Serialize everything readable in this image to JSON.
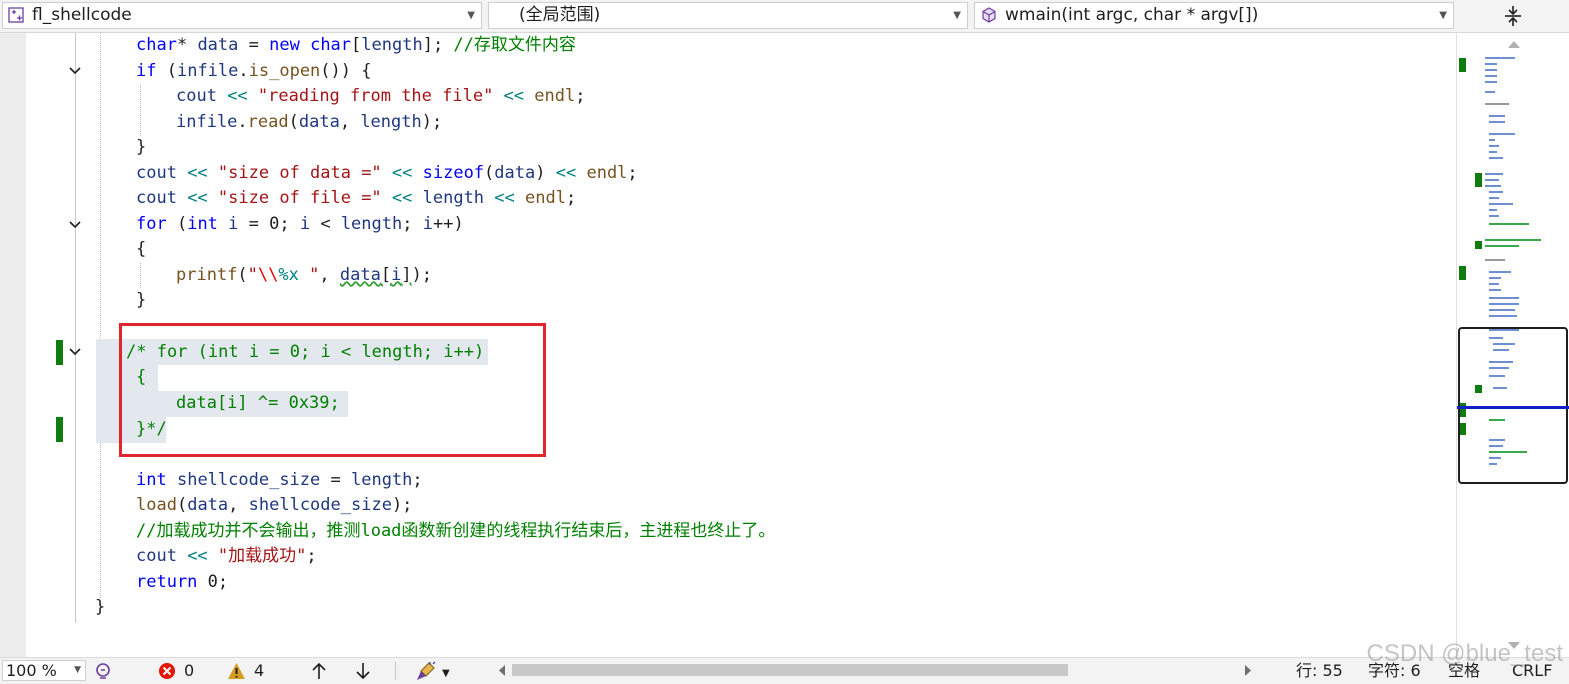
{
  "navbar": {
    "project": "fl_shellcode",
    "scope": "(全局范围)",
    "member": "wmain(int argc, char * argv[])"
  },
  "code": {
    "l1_a": "char",
    "l1_b": "* ",
    "l1_c": "data",
    "l1_d": " = ",
    "l1_e": "new",
    "l1_f": " ",
    "l1_g": "char",
    "l1_h": "[",
    "l1_i": "length",
    "l1_j": "]; ",
    "l1_k": "//存取文件内容",
    "l2_a": "if",
    "l2_b": " (",
    "l2_c": "infile",
    "l2_d": ".",
    "l2_e": "is_open",
    "l2_f": "()) {",
    "l3_a": "cout",
    "l3_b": " << ",
    "l3_c": "\"reading from the file\"",
    "l3_d": " << ",
    "l3_e": "endl",
    "l3_f": ";",
    "l4_a": "infile",
    "l4_b": ".",
    "l4_c": "read",
    "l4_d": "(",
    "l4_e": "data",
    "l4_f": ", ",
    "l4_g": "length",
    "l4_h": ");",
    "l5": "}",
    "l6_a": "cout",
    "l6_b": " << ",
    "l6_c": "\"size of data =\"",
    "l6_d": " << ",
    "l6_e": "sizeof",
    "l6_f": "(",
    "l6_g": "data",
    "l6_h": ") ",
    "l6_i": "<<",
    "l6_j": " ",
    "l6_k": "endl",
    "l6_l": ";",
    "l7_a": "cout",
    "l7_b": " << ",
    "l7_c": "\"size of file =\"",
    "l7_d": " << ",
    "l7_e": "length",
    "l7_f": " << ",
    "l7_g": "endl",
    "l7_h": ";",
    "l8_a": "for",
    "l8_b": " (",
    "l8_c": "int",
    "l8_d": " ",
    "l8_e": "i",
    "l8_f": " = 0; ",
    "l8_g": "i",
    "l8_h": " < ",
    "l8_i": "length",
    "l8_j": "; ",
    "l8_k": "i",
    "l8_l": "++)",
    "l9": "{",
    "l10_a": "printf",
    "l10_b": "(",
    "l10_c": "\"",
    "l10_d": "\\\\",
    "l10_e": "%x",
    "l10_f": " \"",
    "l10_g": ", ",
    "l10_h": "data",
    "l10_i": "[",
    "l10_j": "i",
    "l10_k": "]",
    "l10_l": ");",
    "l11": "}",
    "c1": "/* for (int i = 0; i < length; i++)",
    "c2": "{",
    "c3": "data[i] ^= 0x39;",
    "c4": "}*/",
    "l13_a": "int",
    "l13_b": " ",
    "l13_c": "shellcode_size",
    "l13_d": " = ",
    "l13_e": "length",
    "l13_f": ";",
    "l14_a": "load",
    "l14_b": "(",
    "l14_c": "data",
    "l14_d": ", ",
    "l14_e": "shellcode_size",
    "l14_f": ");",
    "l15": "//加载成功并不会输出，推测load函数新创建的线程执行结束后，主进程也终止了。",
    "l16_a": "cout",
    "l16_b": " << ",
    "l16_c": "\"加载成功\"",
    "l16_d": ";",
    "l17_a": "return",
    "l17_b": " 0;",
    "l18": "}"
  },
  "status": {
    "zoom": "100 %",
    "errors": "0",
    "warnings": "4",
    "line": "行: 55",
    "char": "字符: 6",
    "spaces": "空格",
    "eol": "CRLF"
  },
  "watermark": "CSDN @blue_test",
  "colors": {
    "keyword": "#0000ff",
    "string": "#a31515",
    "comment": "#008000",
    "highlight_box": "#e0262d",
    "change_marker": "#107c10"
  }
}
